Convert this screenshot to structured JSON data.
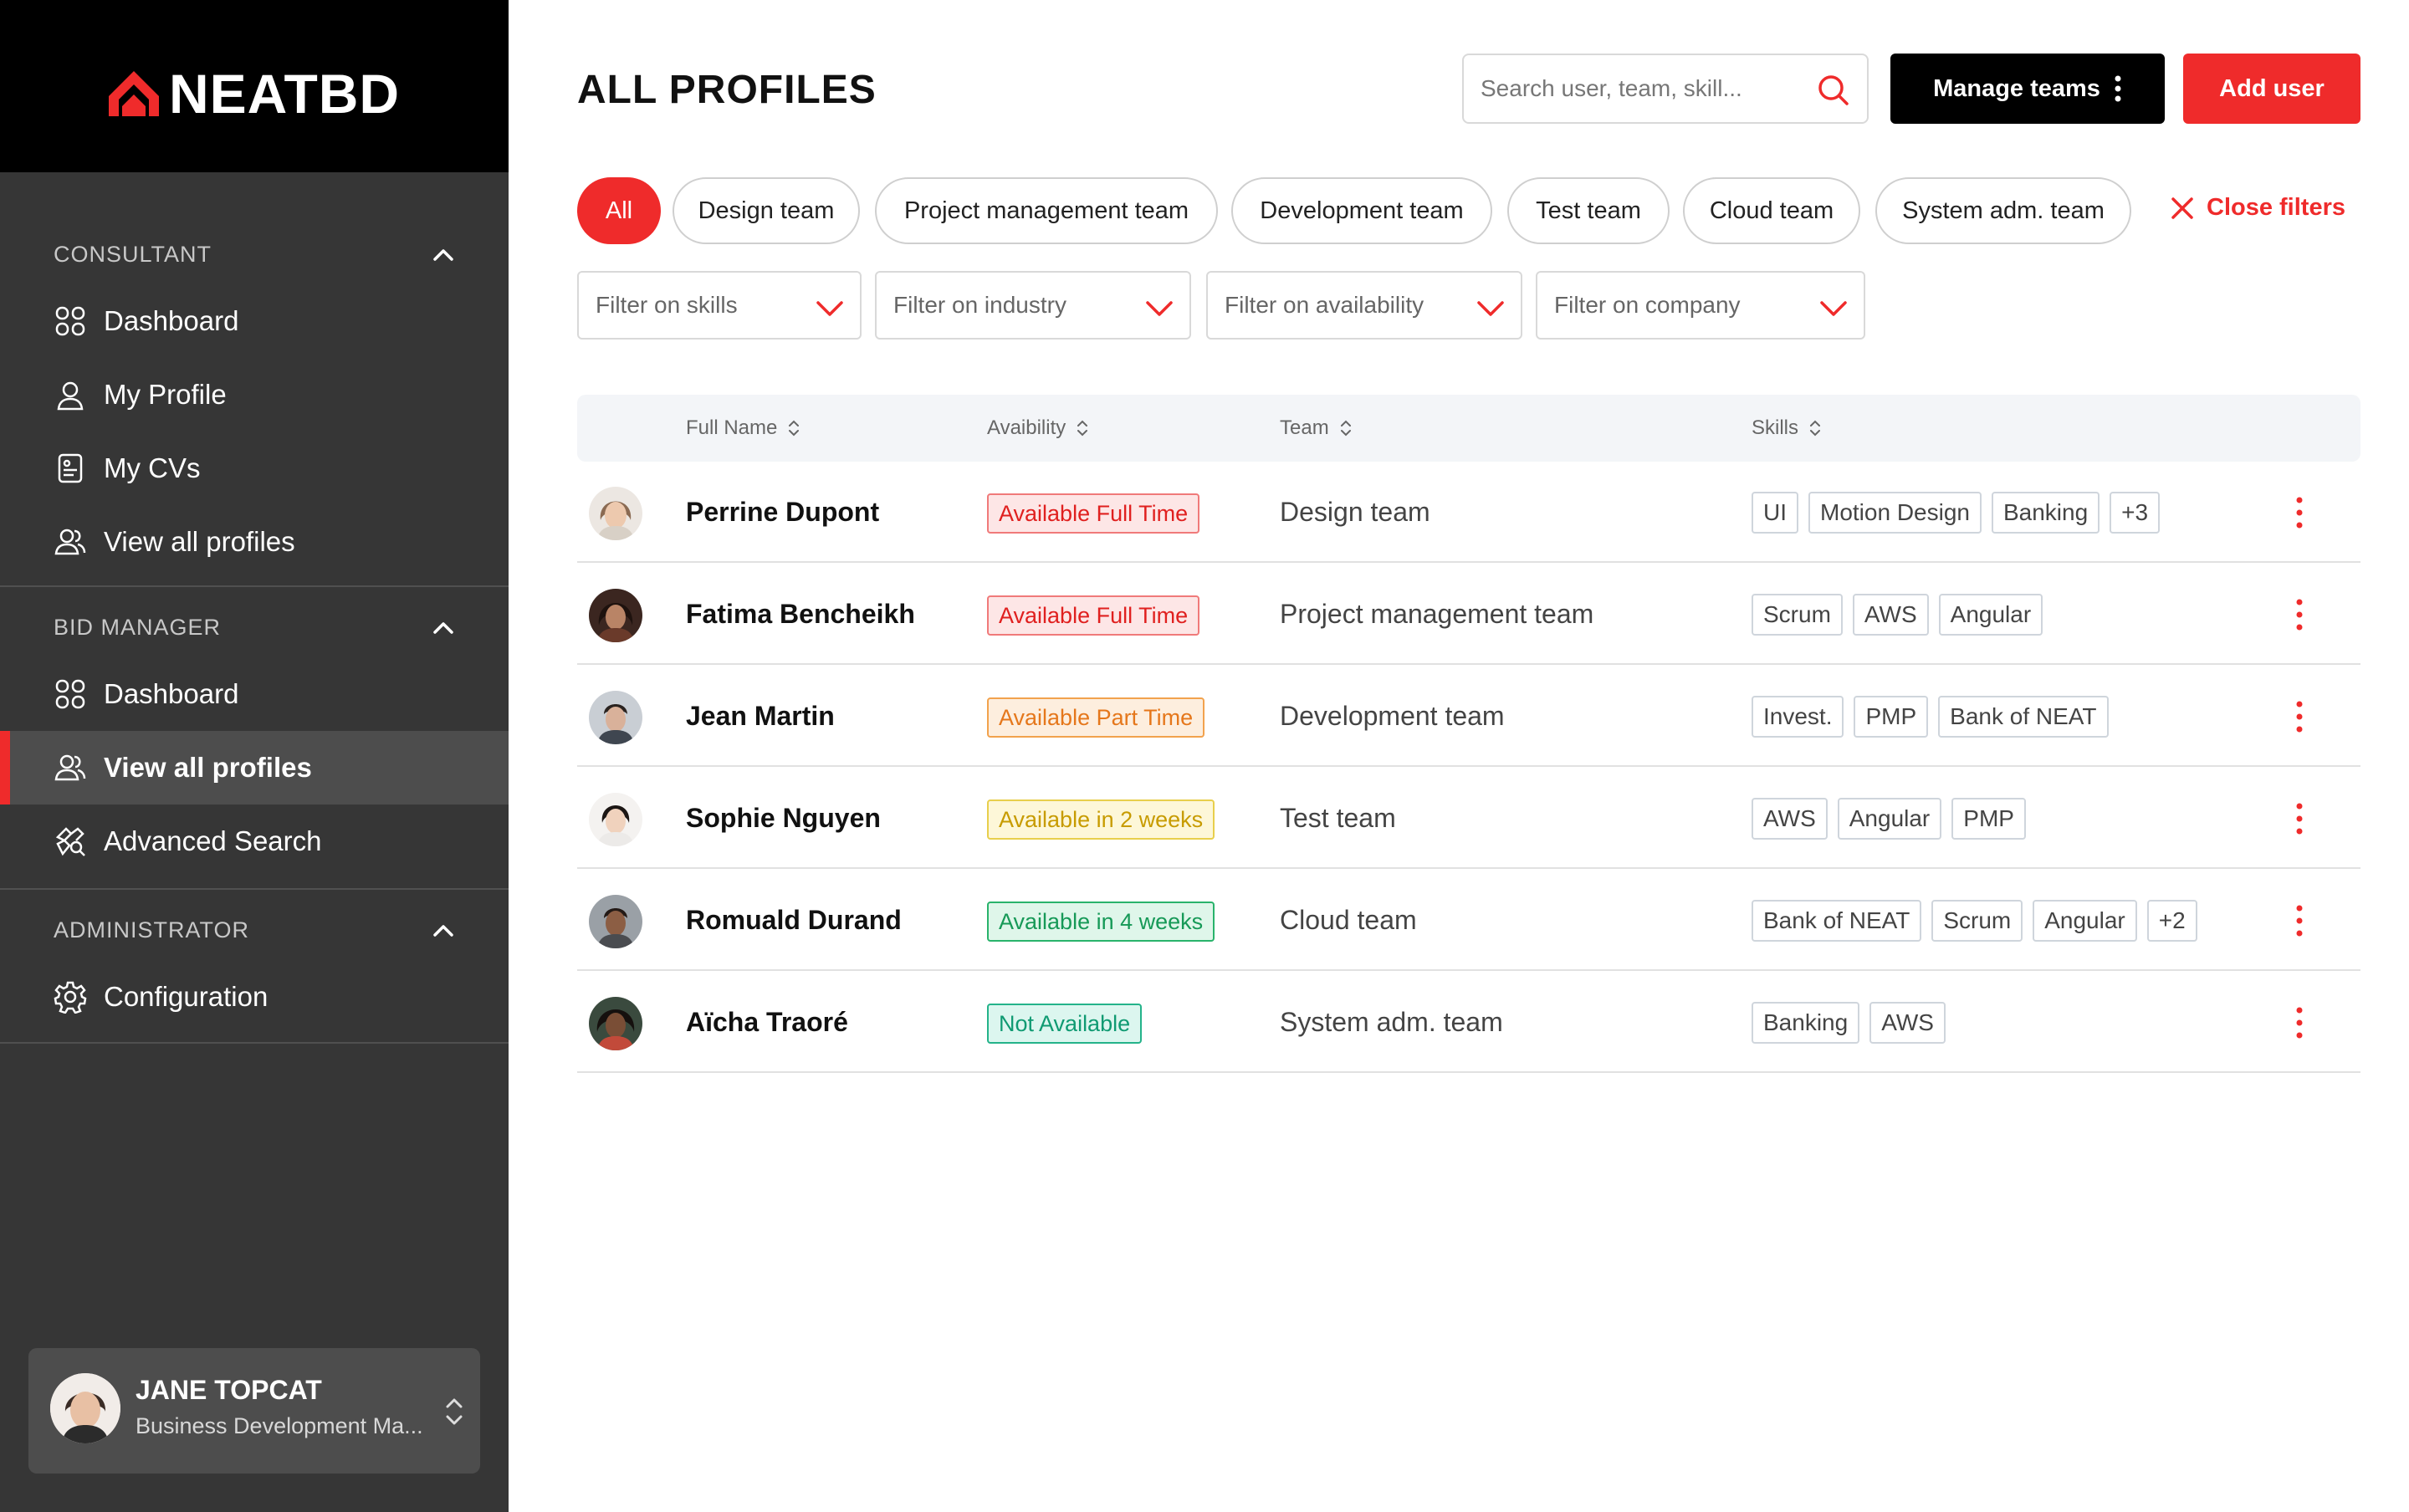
{
  "brand": {
    "name": "NEATBD",
    "accent": "#ef2b2b",
    "sidebar_bg": "#363636"
  },
  "sidebar": {
    "sections": [
      {
        "title": "CONSULTANT",
        "items": [
          {
            "label": "Dashboard",
            "icon": "grid-icon"
          },
          {
            "label": "My Profile",
            "icon": "user-icon"
          },
          {
            "label": "My CVs",
            "icon": "document-icon"
          },
          {
            "label": "View all profiles",
            "icon": "users-icon"
          }
        ]
      },
      {
        "title": "BID MANAGER",
        "items": [
          {
            "label": "Dashboard",
            "icon": "grid-icon"
          },
          {
            "label": "View all profiles",
            "icon": "users-icon",
            "active": true
          },
          {
            "label": "Advanced Search",
            "icon": "search-puzzle-icon"
          }
        ]
      },
      {
        "title": "ADMINISTRATOR",
        "items": [
          {
            "label": "Configuration",
            "icon": "gear-icon"
          }
        ]
      }
    ],
    "user": {
      "name": "JANE TOPCAT",
      "role": "Business Development Ma..."
    }
  },
  "header": {
    "title": "ALL PROFILES",
    "search_placeholder": "Search user, team, skill...",
    "manage_teams_label": "Manage teams",
    "add_user_label": "Add user"
  },
  "team_filters": {
    "chips": [
      "All",
      "Design team",
      "Project management team",
      "Development team",
      "Test team",
      "Cloud team",
      "System adm. team"
    ],
    "active": "All",
    "close_label": "Close filters"
  },
  "dropdown_filters": [
    "Filter on skills",
    "Filter on industry",
    "Filter on availability",
    "Filter on company"
  ],
  "table": {
    "columns": [
      "Full Name",
      "Avaibility",
      "Team",
      "Skills"
    ],
    "rows": [
      {
        "name": "Perrine Dupont",
        "availability": "Available Full Time",
        "status": "red",
        "team": "Design team",
        "skills": [
          "UI",
          "Motion Design",
          "Banking",
          "+3"
        ]
      },
      {
        "name": "Fatima Bencheikh",
        "availability": "Available Full Time",
        "status": "red",
        "team": "Project management team",
        "skills": [
          "Scrum",
          "AWS",
          "Angular"
        ]
      },
      {
        "name": "Jean Martin",
        "availability": "Available Part Time",
        "status": "orange",
        "team": "Development team",
        "skills": [
          "Invest.",
          "PMP",
          "Bank of NEAT"
        ]
      },
      {
        "name": "Sophie Nguyen",
        "availability": "Available in 2 weeks",
        "status": "yellow",
        "team": "Test team",
        "skills": [
          "AWS",
          "Angular",
          "PMP"
        ]
      },
      {
        "name": "Romuald Durand",
        "availability": "Available in 4 weeks",
        "status": "green",
        "team": "Cloud team",
        "skills": [
          "Bank of NEAT",
          "Scrum",
          "Angular",
          "+2"
        ]
      },
      {
        "name": "Aïcha Traoré",
        "availability": "Not Available",
        "status": "teal",
        "team": "System adm. team",
        "skills": [
          "Banking",
          "AWS"
        ]
      }
    ]
  }
}
